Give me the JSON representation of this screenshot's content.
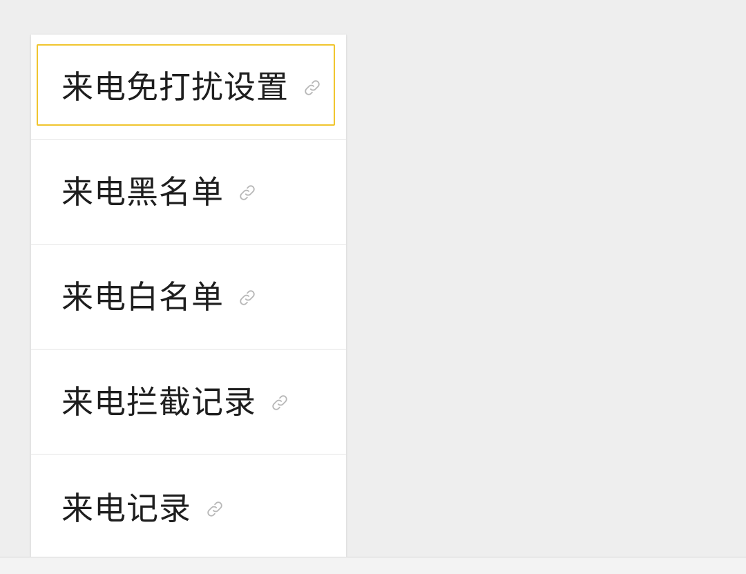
{
  "menu": {
    "items": [
      {
        "label": "来电免打扰设置",
        "icon": "link-icon",
        "selected": true
      },
      {
        "label": "来电黑名单",
        "icon": "link-icon",
        "selected": false
      },
      {
        "label": "来电白名单",
        "icon": "link-icon",
        "selected": false
      },
      {
        "label": "来电拦截记录",
        "icon": "link-icon",
        "selected": false
      },
      {
        "label": "来电记录",
        "icon": "link-icon",
        "selected": false
      }
    ]
  },
  "colors": {
    "background": "#eeeeee",
    "panel": "#ffffff",
    "selection_border": "#f0c52e",
    "text": "#1e1e1e",
    "icon": "#b8b8b8",
    "divider": "#e4e4e4"
  }
}
